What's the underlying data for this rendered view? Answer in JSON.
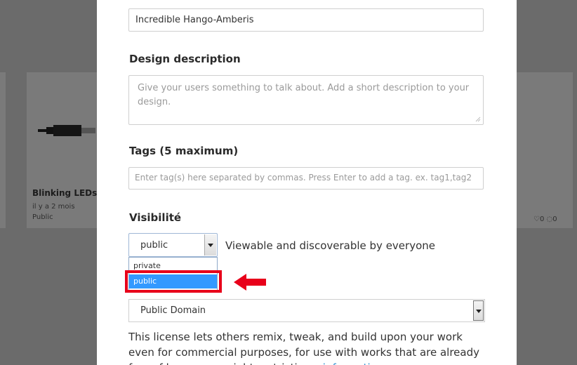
{
  "background_card": {
    "title": "Blinking LEDs",
    "date": "il y a 2 mois",
    "visibility": "Public",
    "stats": "♡0 ◌0"
  },
  "form": {
    "design_name_value": "Incredible Hango-Amberis",
    "description_label": "Design description",
    "description_placeholder": "Give your users something to talk about. Add a short description to your design.",
    "tags_label": "Tags (5 maximum)",
    "tags_placeholder": "Enter tag(s) here separated by commas. Press Enter to add a tag. ex. tag1,tag2",
    "visibility_label": "Visibilité",
    "visibility_selected": "public",
    "visibility_description": "Viewable and discoverable by everyone",
    "visibility_options": [
      "private",
      "public"
    ],
    "license_selected": "Public Domain",
    "license_text": "This license lets others remix, tweak, and build upon your work even for commercial purposes, for use with works that are already free of known copyright restrictions.",
    "license_link": "information"
  },
  "colors": {
    "highlight": "#e8001a",
    "selected_option": "#3399ff",
    "overlay": "#6b6b6b"
  },
  "icons": {
    "dropdown_arrow": "chevron-down-icon",
    "annotation_arrow": "left-arrow-icon"
  }
}
